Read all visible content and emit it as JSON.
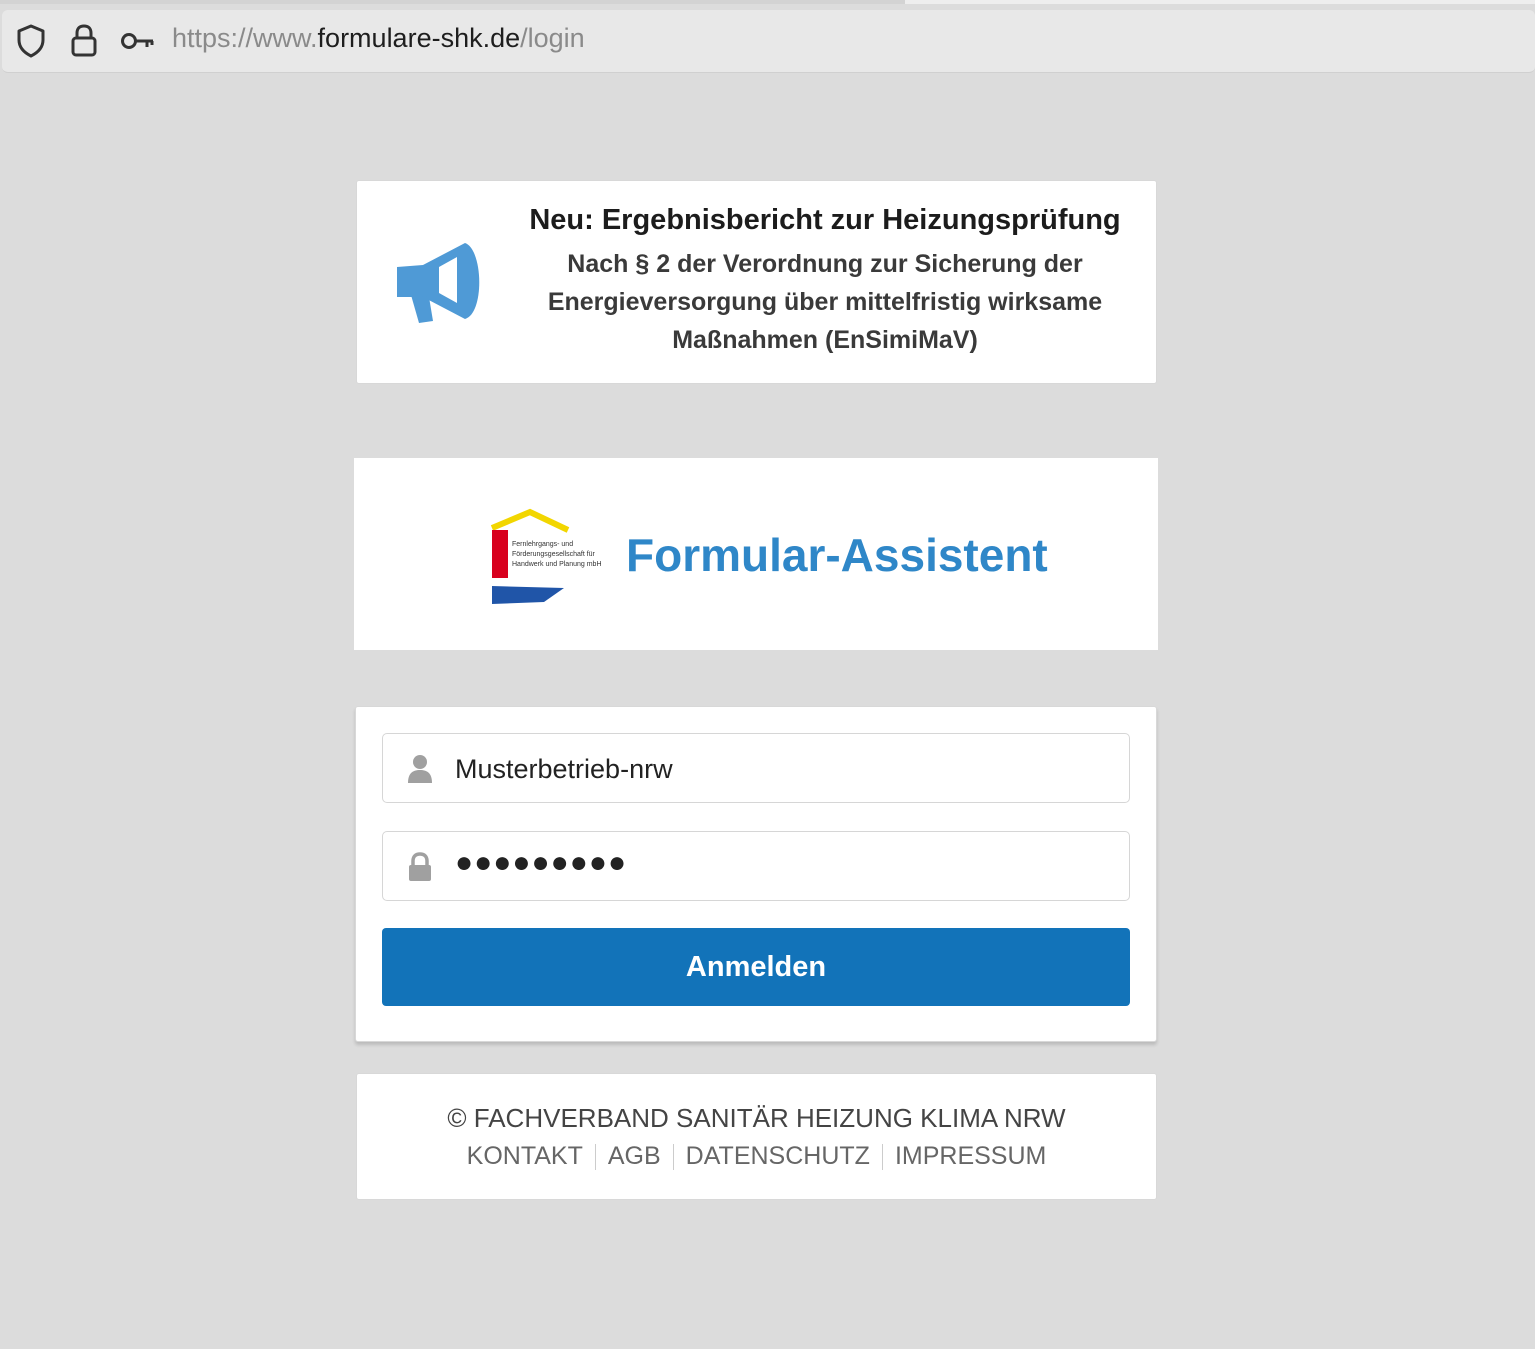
{
  "browser": {
    "url_prefix": "https://www.",
    "url_host": "formulare-shk.de",
    "url_path": "/login"
  },
  "announcement": {
    "title": "Neu: Ergebnisbericht zur Heizungsprüfung",
    "body": "Nach § 2 der Verordnung zur Sicherung der Energieversorgung über mittelfristig wirksame Maßnahmen (EnSimiMaV)",
    "icon": "megaphone-icon",
    "icon_color": "#4f9ad6"
  },
  "brand": {
    "logo_text_line1": "Fernlehrgangs- und",
    "logo_text_line2": "Förderungsgesellschaft für",
    "logo_text_line3": "Handwerk und Planung mbH",
    "app_title": "Formular-Assistent",
    "title_color": "#2f87c8"
  },
  "login": {
    "username_value": "Musterbetrieb-nrw",
    "password_value": "●●●●●●●●●",
    "submit_label": "Anmelden",
    "button_color": "#1273b9"
  },
  "footer": {
    "copyright": "© FACHVERBAND SANITÄR HEIZUNG KLIMA NRW",
    "links": [
      "KONTAKT",
      "AGB",
      "DATENSCHUTZ",
      "IMPRESSUM"
    ]
  }
}
